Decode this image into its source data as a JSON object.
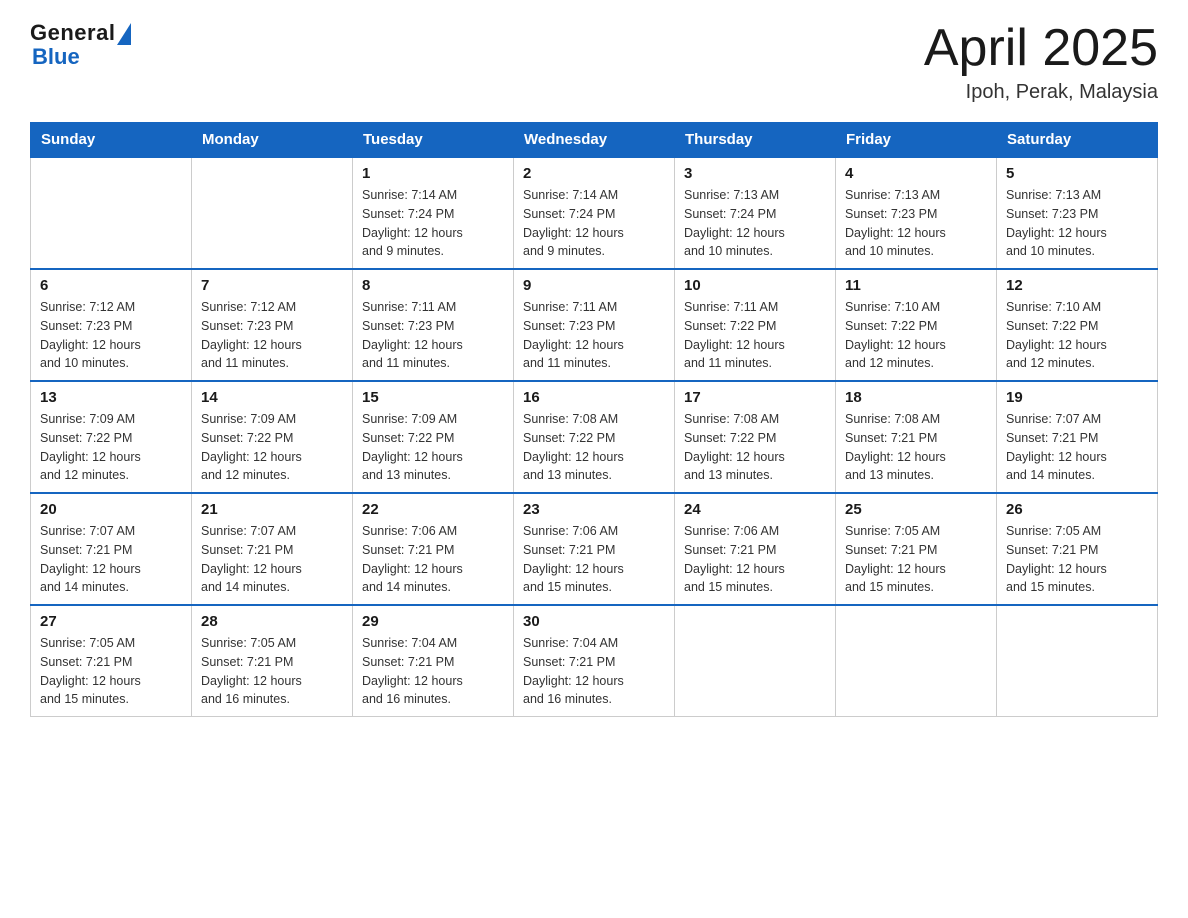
{
  "header": {
    "logo_general": "General",
    "logo_blue": "Blue",
    "month_title": "April 2025",
    "location": "Ipoh, Perak, Malaysia"
  },
  "weekdays": [
    "Sunday",
    "Monday",
    "Tuesday",
    "Wednesday",
    "Thursday",
    "Friday",
    "Saturday"
  ],
  "weeks": [
    [
      {
        "day": "",
        "info": ""
      },
      {
        "day": "",
        "info": ""
      },
      {
        "day": "1",
        "info": "Sunrise: 7:14 AM\nSunset: 7:24 PM\nDaylight: 12 hours\nand 9 minutes."
      },
      {
        "day": "2",
        "info": "Sunrise: 7:14 AM\nSunset: 7:24 PM\nDaylight: 12 hours\nand 9 minutes."
      },
      {
        "day": "3",
        "info": "Sunrise: 7:13 AM\nSunset: 7:24 PM\nDaylight: 12 hours\nand 10 minutes."
      },
      {
        "day": "4",
        "info": "Sunrise: 7:13 AM\nSunset: 7:23 PM\nDaylight: 12 hours\nand 10 minutes."
      },
      {
        "day": "5",
        "info": "Sunrise: 7:13 AM\nSunset: 7:23 PM\nDaylight: 12 hours\nand 10 minutes."
      }
    ],
    [
      {
        "day": "6",
        "info": "Sunrise: 7:12 AM\nSunset: 7:23 PM\nDaylight: 12 hours\nand 10 minutes."
      },
      {
        "day": "7",
        "info": "Sunrise: 7:12 AM\nSunset: 7:23 PM\nDaylight: 12 hours\nand 11 minutes."
      },
      {
        "day": "8",
        "info": "Sunrise: 7:11 AM\nSunset: 7:23 PM\nDaylight: 12 hours\nand 11 minutes."
      },
      {
        "day": "9",
        "info": "Sunrise: 7:11 AM\nSunset: 7:23 PM\nDaylight: 12 hours\nand 11 minutes."
      },
      {
        "day": "10",
        "info": "Sunrise: 7:11 AM\nSunset: 7:22 PM\nDaylight: 12 hours\nand 11 minutes."
      },
      {
        "day": "11",
        "info": "Sunrise: 7:10 AM\nSunset: 7:22 PM\nDaylight: 12 hours\nand 12 minutes."
      },
      {
        "day": "12",
        "info": "Sunrise: 7:10 AM\nSunset: 7:22 PM\nDaylight: 12 hours\nand 12 minutes."
      }
    ],
    [
      {
        "day": "13",
        "info": "Sunrise: 7:09 AM\nSunset: 7:22 PM\nDaylight: 12 hours\nand 12 minutes."
      },
      {
        "day": "14",
        "info": "Sunrise: 7:09 AM\nSunset: 7:22 PM\nDaylight: 12 hours\nand 12 minutes."
      },
      {
        "day": "15",
        "info": "Sunrise: 7:09 AM\nSunset: 7:22 PM\nDaylight: 12 hours\nand 13 minutes."
      },
      {
        "day": "16",
        "info": "Sunrise: 7:08 AM\nSunset: 7:22 PM\nDaylight: 12 hours\nand 13 minutes."
      },
      {
        "day": "17",
        "info": "Sunrise: 7:08 AM\nSunset: 7:22 PM\nDaylight: 12 hours\nand 13 minutes."
      },
      {
        "day": "18",
        "info": "Sunrise: 7:08 AM\nSunset: 7:21 PM\nDaylight: 12 hours\nand 13 minutes."
      },
      {
        "day": "19",
        "info": "Sunrise: 7:07 AM\nSunset: 7:21 PM\nDaylight: 12 hours\nand 14 minutes."
      }
    ],
    [
      {
        "day": "20",
        "info": "Sunrise: 7:07 AM\nSunset: 7:21 PM\nDaylight: 12 hours\nand 14 minutes."
      },
      {
        "day": "21",
        "info": "Sunrise: 7:07 AM\nSunset: 7:21 PM\nDaylight: 12 hours\nand 14 minutes."
      },
      {
        "day": "22",
        "info": "Sunrise: 7:06 AM\nSunset: 7:21 PM\nDaylight: 12 hours\nand 14 minutes."
      },
      {
        "day": "23",
        "info": "Sunrise: 7:06 AM\nSunset: 7:21 PM\nDaylight: 12 hours\nand 15 minutes."
      },
      {
        "day": "24",
        "info": "Sunrise: 7:06 AM\nSunset: 7:21 PM\nDaylight: 12 hours\nand 15 minutes."
      },
      {
        "day": "25",
        "info": "Sunrise: 7:05 AM\nSunset: 7:21 PM\nDaylight: 12 hours\nand 15 minutes."
      },
      {
        "day": "26",
        "info": "Sunrise: 7:05 AM\nSunset: 7:21 PM\nDaylight: 12 hours\nand 15 minutes."
      }
    ],
    [
      {
        "day": "27",
        "info": "Sunrise: 7:05 AM\nSunset: 7:21 PM\nDaylight: 12 hours\nand 15 minutes."
      },
      {
        "day": "28",
        "info": "Sunrise: 7:05 AM\nSunset: 7:21 PM\nDaylight: 12 hours\nand 16 minutes."
      },
      {
        "day": "29",
        "info": "Sunrise: 7:04 AM\nSunset: 7:21 PM\nDaylight: 12 hours\nand 16 minutes."
      },
      {
        "day": "30",
        "info": "Sunrise: 7:04 AM\nSunset: 7:21 PM\nDaylight: 12 hours\nand 16 minutes."
      },
      {
        "day": "",
        "info": ""
      },
      {
        "day": "",
        "info": ""
      },
      {
        "day": "",
        "info": ""
      }
    ]
  ]
}
